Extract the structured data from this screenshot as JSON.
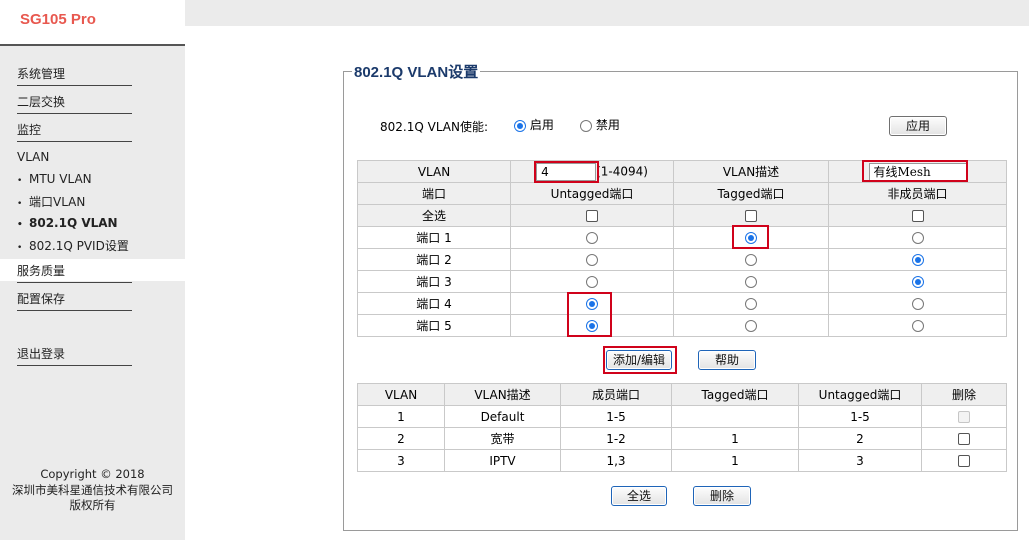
{
  "brand": "SG105 Pro",
  "sidebar": {
    "items": [
      {
        "label": "系统管理"
      },
      {
        "label": "二层交换"
      },
      {
        "label": "监控"
      }
    ],
    "vlan_header": "VLAN",
    "vlan_sub": [
      {
        "label": "MTU VLAN"
      },
      {
        "label": "端口VLAN"
      },
      {
        "label": "802.1Q VLAN",
        "active": true
      },
      {
        "label": "802.1Q PVID设置"
      }
    ],
    "items2": [
      {
        "label": "服务质量"
      },
      {
        "label": "配置保存"
      },
      {
        "label": "退出登录"
      }
    ],
    "copyright": [
      "Copyright © 2018",
      "深圳市美科星通信技术有限公司",
      "版权所有"
    ]
  },
  "panel": {
    "title": "802.1Q VLAN设置",
    "enable_label": "802.1Q VLAN使能:",
    "enable_on": "启用",
    "enable_off": "禁用",
    "enable_state": "on",
    "apply": "应用"
  },
  "config": {
    "vlan_label": "VLAN",
    "vlan_value": "4",
    "vlan_range": "(1-4094)",
    "desc_label": "VLAN描述",
    "desc_value": "有线Mesh",
    "col_port": "端口",
    "col_untagged": "Untagged端口",
    "col_tagged": "Tagged端口",
    "col_nonmember": "非成员端口",
    "select_all": "全选",
    "ports": [
      {
        "label": "端口 1",
        "mode": "tagged"
      },
      {
        "label": "端口 2",
        "mode": "nonmember"
      },
      {
        "label": "端口 3",
        "mode": "nonmember"
      },
      {
        "label": "端口 4",
        "mode": "untagged"
      },
      {
        "label": "端口 5",
        "mode": "untagged"
      }
    ]
  },
  "actions": {
    "add_edit": "添加/编辑",
    "help": "帮助"
  },
  "list": {
    "headers": [
      "VLAN",
      "VLAN描述",
      "成员端口",
      "Tagged端口",
      "Untagged端口",
      "删除"
    ],
    "rows": [
      {
        "vlan": "1",
        "desc": "Default",
        "members": "1-5",
        "tagged": "",
        "untagged": "1-5",
        "deletable": false
      },
      {
        "vlan": "2",
        "desc": "宽带",
        "members": "1-2",
        "tagged": "1",
        "untagged": "2",
        "deletable": true
      },
      {
        "vlan": "3",
        "desc": "IPTV",
        "members": "1,3",
        "tagged": "1",
        "untagged": "3",
        "deletable": true
      }
    ],
    "select_all": "全选",
    "delete": "删除"
  }
}
